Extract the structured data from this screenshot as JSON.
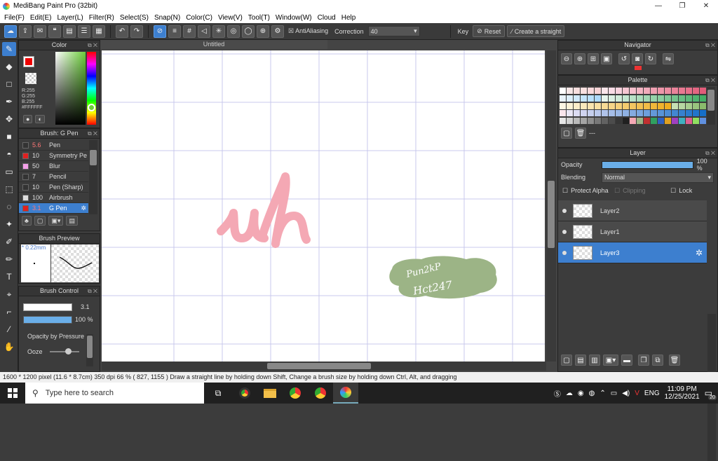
{
  "window": {
    "title": "MediBang Paint Pro (32bit)",
    "min": "—",
    "max": "❐",
    "close": "✕"
  },
  "menu": [
    "File(F)",
    "Edit(E)",
    "Layer(L)",
    "Filter(R)",
    "Select(S)",
    "Snap(N)",
    "Color(C)",
    "View(V)",
    "Tool(T)",
    "Window(W)",
    "Cloud",
    "Help"
  ],
  "toolbar": {
    "antialias_label": "AntiAliasing",
    "correction_label": "Correction",
    "correction_value": "40",
    "key_label": "Key",
    "reset_label": "Reset",
    "straight_label": "Create a straight"
  },
  "color_panel": {
    "title": "Color",
    "r": "R:255",
    "g": "G:255",
    "b": "B:255",
    "hex": "#FFFFFF",
    "fg": "#ff0000",
    "bg": "#ffffff"
  },
  "brush_panel": {
    "title": "Brush: G Pen",
    "items": [
      {
        "size": "5.6",
        "name": "Pen",
        "color": "#333333"
      },
      {
        "size": "10",
        "name": "Symmetry Pe",
        "color": "#e02020"
      },
      {
        "size": "50",
        "name": "Blur",
        "color": "#f4a0e8"
      },
      {
        "size": "7",
        "name": "Pencil",
        "color": "#333333"
      },
      {
        "size": "10",
        "name": "Pen (Sharp)",
        "color": "#333333"
      },
      {
        "size": "100",
        "name": "Airbrush",
        "color": "#dddddd"
      },
      {
        "size": "3.1",
        "name": "G Pen",
        "color": "#e02020"
      }
    ]
  },
  "brush_preview": {
    "title": "Brush Preview",
    "size": "* 0.22mm"
  },
  "brush_control": {
    "title": "Brush Control",
    "size_value": "3.1",
    "opacity_value": "100 %",
    "pressure_label": "Opacity by Pressure",
    "ooze_label": "Ooze"
  },
  "canvas": {
    "doc_title": "Untitled",
    "lettering": "uh",
    "sticker_line1": "Pun2kP",
    "sticker_line2": "Hct247"
  },
  "navigator": {
    "title": "Navigator"
  },
  "palette": {
    "title": "Palette",
    "name": "---"
  },
  "layer_panel": {
    "title": "Layer",
    "opacity_label": "Opacity",
    "opacity_value": "100 %",
    "opacity_fraction": 1.0,
    "blending_label": "Blending",
    "blending_value": "Normal",
    "protect_alpha": "Protect Alpha",
    "clipping": "Clipping",
    "lock": "Lock",
    "layers": [
      {
        "name": "Layer2",
        "selected": false
      },
      {
        "name": "Layer1",
        "selected": false
      },
      {
        "name": "Layer3",
        "selected": true
      }
    ]
  },
  "status": {
    "text": "1600 * 1200 pixel   (11.6 * 8.7cm)   350 dpi   66 %   ( 827, 1155 )   Draw a straight line by holding down Shift, Change a brush size by holding down Ctrl, Alt, and dragging"
  },
  "taskbar": {
    "search_placeholder": "Type here to search",
    "lang": "ENG",
    "time": "11:09 PM",
    "date": "12/25/2021",
    "notif": "20"
  }
}
